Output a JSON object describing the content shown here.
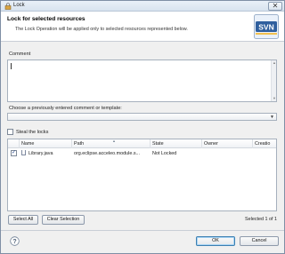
{
  "window": {
    "title": "Lock",
    "close_glyph": "✕"
  },
  "banner": {
    "title": "Lock for selected resources",
    "description": "The Lock Operation will be applied only to selected resources represented below.",
    "logo_text": "SVN"
  },
  "comment": {
    "label": "Comment",
    "value": ""
  },
  "template": {
    "label": "Choose a previously entered comment or template:",
    "selected": ""
  },
  "steal_locks": {
    "label": "Steal the locks",
    "checked": false
  },
  "table": {
    "columns": [
      "Name",
      "Path",
      "State",
      "Owner",
      "Creatio"
    ],
    "rows": [
      {
        "checked": true,
        "name": "Library.java",
        "path": "org.eclipse.acceleo.module.s...",
        "state": "Not Locked",
        "owner": "",
        "creation": ""
      }
    ]
  },
  "buttons": {
    "select_all": "Select All",
    "clear_selection": "Clear Selection",
    "ok": "OK",
    "cancel": "Cancel"
  },
  "status": {
    "selected_count": "Selected 1 of 1"
  },
  "colors": {
    "accent": "#3c7fb1",
    "svn_blue": "#2f5f9e",
    "banner_bg": "#ffffff"
  },
  "icons": {
    "title": "lock-icon",
    "logo": "svn-logo",
    "file": "java-file-icon",
    "help": "help-icon"
  }
}
